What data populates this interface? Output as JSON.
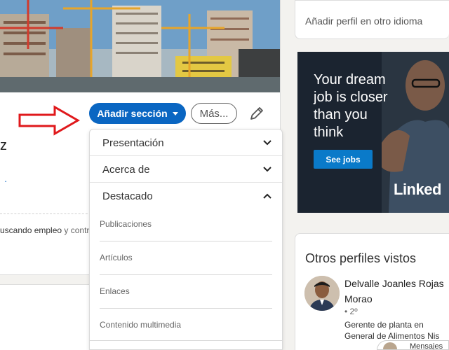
{
  "profile": {
    "name_fragment": "z",
    "dot_fragment": "·",
    "status_fragment": "uscando empleo",
    "status_suffix": " y contr"
  },
  "actions": {
    "add_section_label": "Añadir sección",
    "more_label": "Más..."
  },
  "dropdown": {
    "sections": [
      {
        "label": "Presentación",
        "expanded": false
      },
      {
        "label": "Acerca de",
        "expanded": false
      },
      {
        "label": "Destacado",
        "expanded": true
      }
    ],
    "featured_items": [
      "Publicaciones",
      "Artículos",
      "Enlaces",
      "Contenido multimedia"
    ]
  },
  "sidebar": {
    "add_language_profile": "Añadir perfil en otro idioma"
  },
  "ad": {
    "headline": "Your dream job is closer than you think",
    "cta": "See jobs",
    "brand": "Linked"
  },
  "others": {
    "title": "Otros perfiles vistos",
    "people": [
      {
        "name": "Delvalle Joanles Rojas Morao",
        "degree": "• 2º",
        "headline": "Gerente de planta en General de Alimentos Nis"
      }
    ]
  },
  "messaging": {
    "label": "Mensajes"
  },
  "colors": {
    "accent": "#0a66c2",
    "arrow": "#e0191c"
  }
}
